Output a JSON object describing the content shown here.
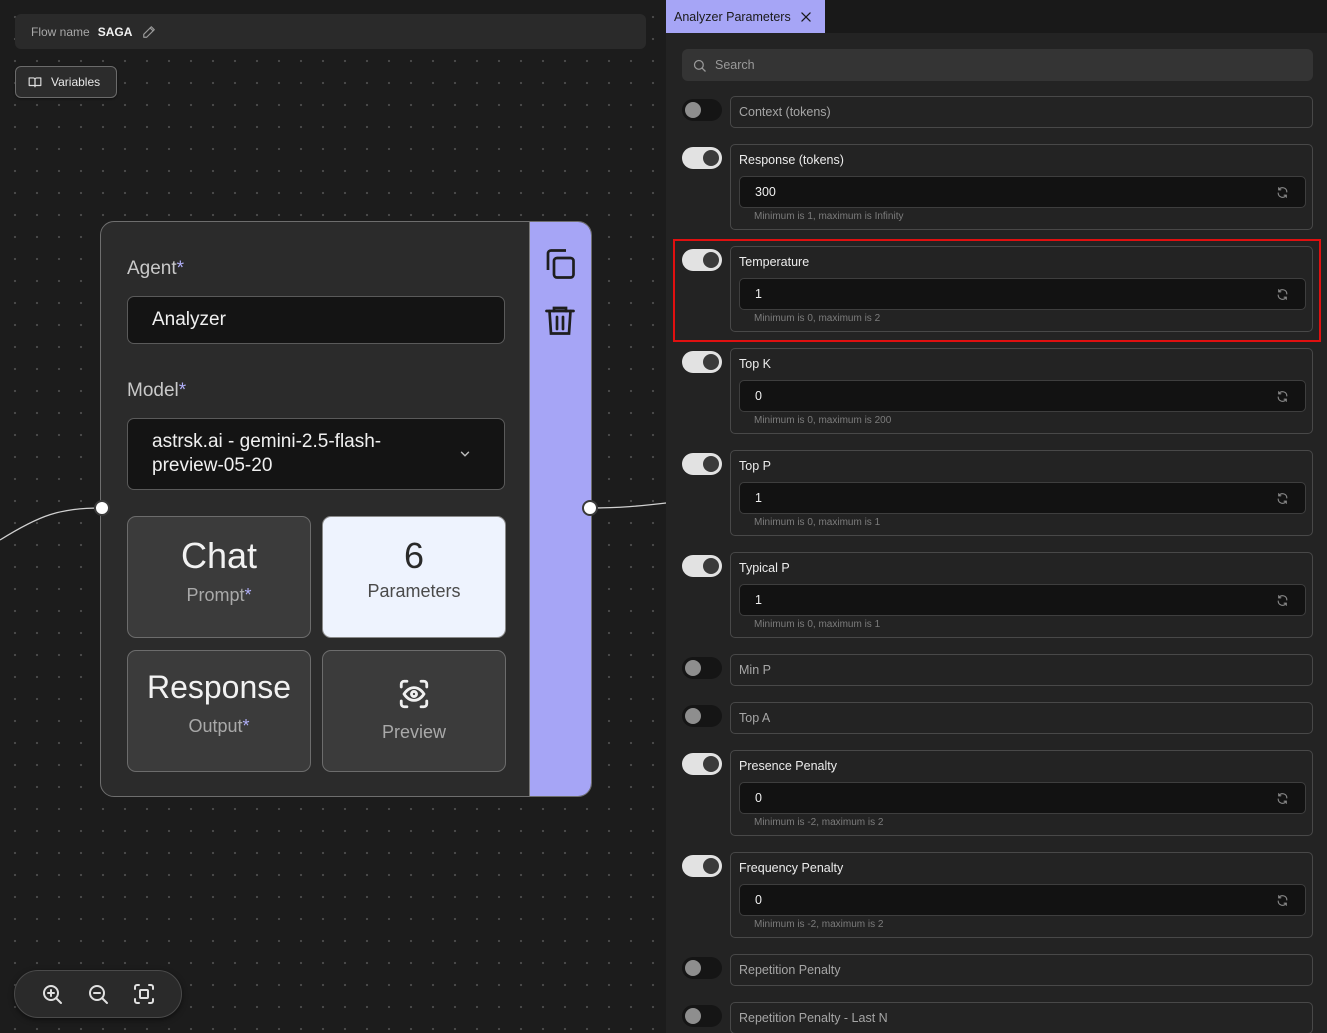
{
  "flow": {
    "name_label": "Flow name",
    "name_value": "SAGA"
  },
  "variables_button": {
    "label": "Variables"
  },
  "agent_node": {
    "agent_label": "Agent",
    "agent_value": "Analyzer",
    "model_label": "Model",
    "model_value_line1": "astrsk.ai - gemini-2.5-flash-",
    "model_value_line2": "preview-05-20",
    "required_mark": "*",
    "tiles": {
      "chat": {
        "title": "Chat",
        "subtitle": "Prompt"
      },
      "parameters": {
        "title": "6",
        "subtitle": "Parameters"
      },
      "response": {
        "title": "Response",
        "subtitle": "Output"
      },
      "preview": {
        "title": "Preview"
      }
    },
    "accent_color": "#a6a5f6"
  },
  "panel": {
    "tab_title": "Analyzer Parameters",
    "search_placeholder": "Search",
    "params": [
      {
        "name": "Context (tokens)",
        "enabled": false
      },
      {
        "name": "Response (tokens)",
        "enabled": true,
        "value": "300",
        "hint": "Minimum is 1, maximum is Infinity"
      },
      {
        "name": "Temperature",
        "enabled": true,
        "value": "1",
        "hint": "Minimum is 0, maximum is 2"
      },
      {
        "name": "Top K",
        "enabled": true,
        "value": "0",
        "hint": "Minimum is 0, maximum is 200"
      },
      {
        "name": "Top P",
        "enabled": true,
        "value": "1",
        "hint": "Minimum is 0, maximum is 1"
      },
      {
        "name": "Typical P",
        "enabled": true,
        "value": "1",
        "hint": "Minimum is 0, maximum is 1"
      },
      {
        "name": "Min P",
        "enabled": false
      },
      {
        "name": "Top A",
        "enabled": false
      },
      {
        "name": "Presence Penalty",
        "enabled": true,
        "value": "0",
        "hint": "Minimum is -2, maximum is 2"
      },
      {
        "name": "Frequency Penalty",
        "enabled": true,
        "value": "0",
        "hint": "Minimum is -2, maximum is 2"
      },
      {
        "name": "Repetition Penalty",
        "enabled": false
      },
      {
        "name": "Repetition Penalty - Last N",
        "enabled": false
      }
    ]
  },
  "highlight_color": "#e01010"
}
